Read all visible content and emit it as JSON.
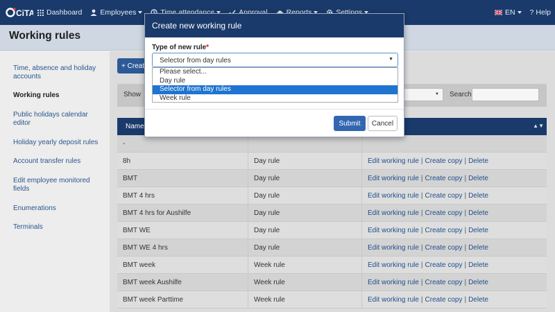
{
  "app": {
    "logo_text": "CiTA"
  },
  "navbar": {
    "items": [
      {
        "label": "Dashboard",
        "icon": "grid-icon"
      },
      {
        "label": "Employees",
        "icon": "user-icon"
      },
      {
        "label": "Time attendance",
        "icon": "clock-icon"
      },
      {
        "label": "Approval",
        "icon": "check-icon"
      },
      {
        "label": "Reports",
        "icon": "cloud-icon"
      },
      {
        "label": "Settings",
        "icon": "gear-icon"
      }
    ],
    "language": "EN",
    "help": "Help"
  },
  "page": {
    "title": "Working rules"
  },
  "sidebar": {
    "items": [
      {
        "label": "Time, absence and holiday accounts"
      },
      {
        "label": "Working rules",
        "active": true
      },
      {
        "label": "Public holidays calendar editor"
      },
      {
        "label": "Holiday yearly deposit rules"
      },
      {
        "label": "Account transfer rules"
      },
      {
        "label": "Edit employee monitored fields"
      },
      {
        "label": "Enumerations"
      },
      {
        "label": "Terminals"
      }
    ]
  },
  "toolbar": {
    "create_label": "+ Create"
  },
  "filter": {
    "show_label": "Show",
    "search_label": "Search"
  },
  "table": {
    "header": "Name",
    "rows": [
      {
        "name": "-",
        "type": "",
        "actions": ""
      },
      {
        "name": "8h",
        "type": "Day rule"
      },
      {
        "name": "BMT",
        "type": "Day rule"
      },
      {
        "name": "BMT 4 hrs",
        "type": "Day rule"
      },
      {
        "name": "BMT 4 hrs for Aushilfe",
        "type": "Day rule"
      },
      {
        "name": "BMT WE",
        "type": "Day rule"
      },
      {
        "name": "BMT WE 4 hrs",
        "type": "Day rule"
      },
      {
        "name": "BMT week",
        "type": "Week rule"
      },
      {
        "name": "BMT week Aushilfe",
        "type": "Week rule"
      },
      {
        "name": "BMT week Parttime",
        "type": "Week rule"
      }
    ],
    "action_edit": "Edit working rule",
    "action_copy": "Create copy",
    "action_delete": "Delete",
    "action_sep": "|"
  },
  "modal": {
    "title": "Create new working rule",
    "field_label": "Type of new rule",
    "required_mark": "*",
    "selected_value": "Selector from day rules",
    "options": [
      {
        "label": "Please select..."
      },
      {
        "label": "Day rule"
      },
      {
        "label": "Selector from day rules",
        "selected": true
      },
      {
        "label": "Week rule"
      }
    ],
    "submit_label": "Submit",
    "cancel_label": "Cancel"
  },
  "colors": {
    "navbar": "#1a3a6b",
    "accent": "#3366b1",
    "highlight": "#1e74d0",
    "link": "#1f4e8c"
  }
}
